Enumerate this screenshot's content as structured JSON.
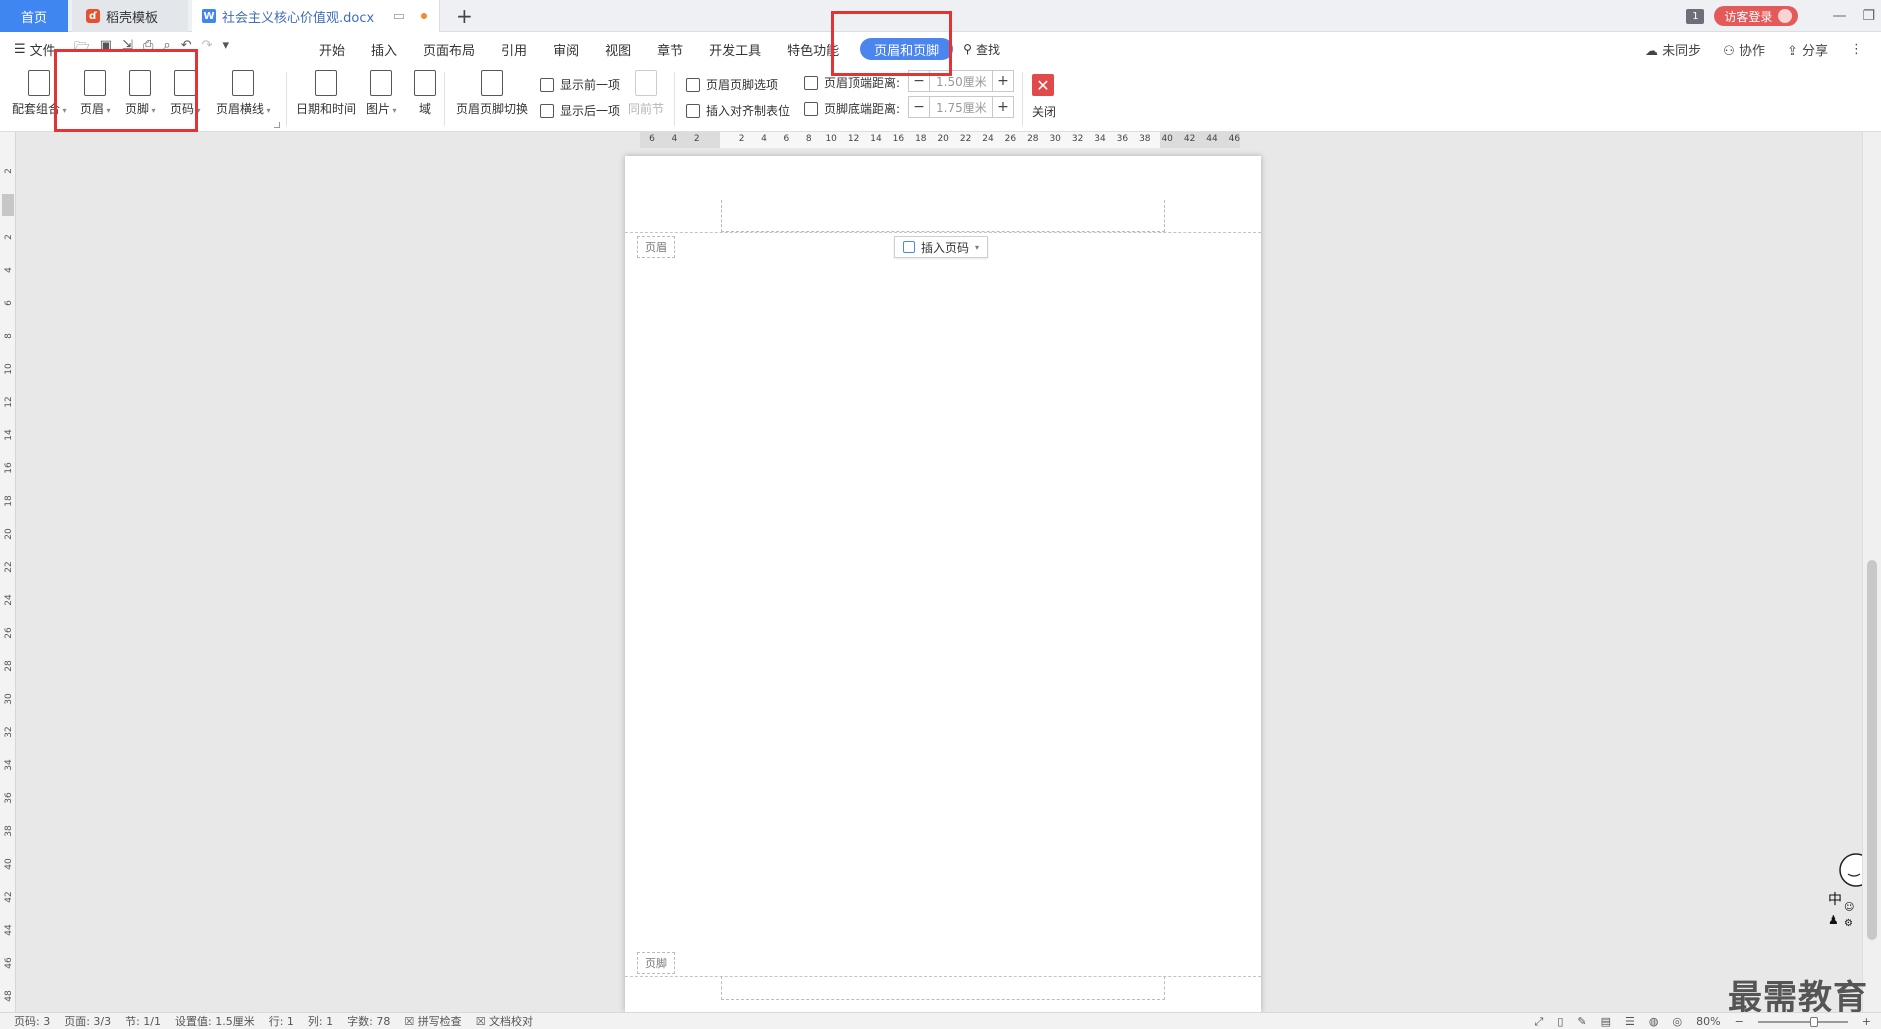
{
  "tabs": {
    "home": "首页",
    "template": "稻壳模板",
    "document": "社会主义核心价值观.docx"
  },
  "titlebar_right": {
    "badge": "1",
    "login": "访客登录"
  },
  "menu": {
    "file": "文件",
    "ribbon_tabs": [
      "开始",
      "插入",
      "页面布局",
      "引用",
      "审阅",
      "视图",
      "章节",
      "开发工具",
      "特色功能"
    ],
    "active_tab": "页眉和页脚",
    "search": "查找",
    "sync": "未同步",
    "collab": "协作",
    "share": "分享"
  },
  "ribbon": {
    "combo": "配套组合",
    "header": "页眉",
    "footer": "页脚",
    "page_number": "页码",
    "header_line": "页眉横线",
    "datetime": "日期和时间",
    "picture": "图片",
    "field": "域",
    "switch": "页眉页脚切换",
    "show_prev": "显示前一项",
    "show_next": "显示后一项",
    "same_as_prev": "同前节",
    "options": "页眉页脚选项",
    "insert_align_tab": "插入对齐制表位",
    "header_top_label": "页眉顶端距离:",
    "header_top_value": "1.50厘米",
    "footer_bottom_label": "页脚底端距离:",
    "footer_bottom_value": "1.75厘米",
    "close": "关闭"
  },
  "ruler": {
    "horizontal": [
      "6",
      "4",
      "2",
      "",
      "2",
      "4",
      "6",
      "8",
      "10",
      "12",
      "14",
      "16",
      "18",
      "20",
      "22",
      "24",
      "26",
      "28",
      "30",
      "32",
      "34",
      "36",
      "38",
      "40",
      "42",
      "44",
      "46"
    ],
    "vertical": [
      "2",
      "",
      "2",
      "4",
      "6",
      "8",
      "10",
      "12",
      "14",
      "16",
      "18",
      "20",
      "22",
      "24",
      "26",
      "28",
      "30",
      "32",
      "34",
      "36",
      "38",
      "40",
      "42",
      "44",
      "46",
      "48"
    ]
  },
  "page": {
    "header_tag": "页眉",
    "insert_page_number": "插入页码",
    "footer_tag": "页脚"
  },
  "status": {
    "page": "页码: 3",
    "pages": "页面: 3/3",
    "section": "节: 1/1",
    "setting": "设置值: 1.5厘米",
    "row": "行: 1",
    "col": "列: 1",
    "words": "字数: 78",
    "spell": "拼写检查",
    "proof": "文档校对",
    "zoom": "80%"
  },
  "watermark": "最需教育",
  "colors": {
    "accent": "#4a86ee",
    "annotation": "#e23434",
    "close": "#e04a4a"
  }
}
